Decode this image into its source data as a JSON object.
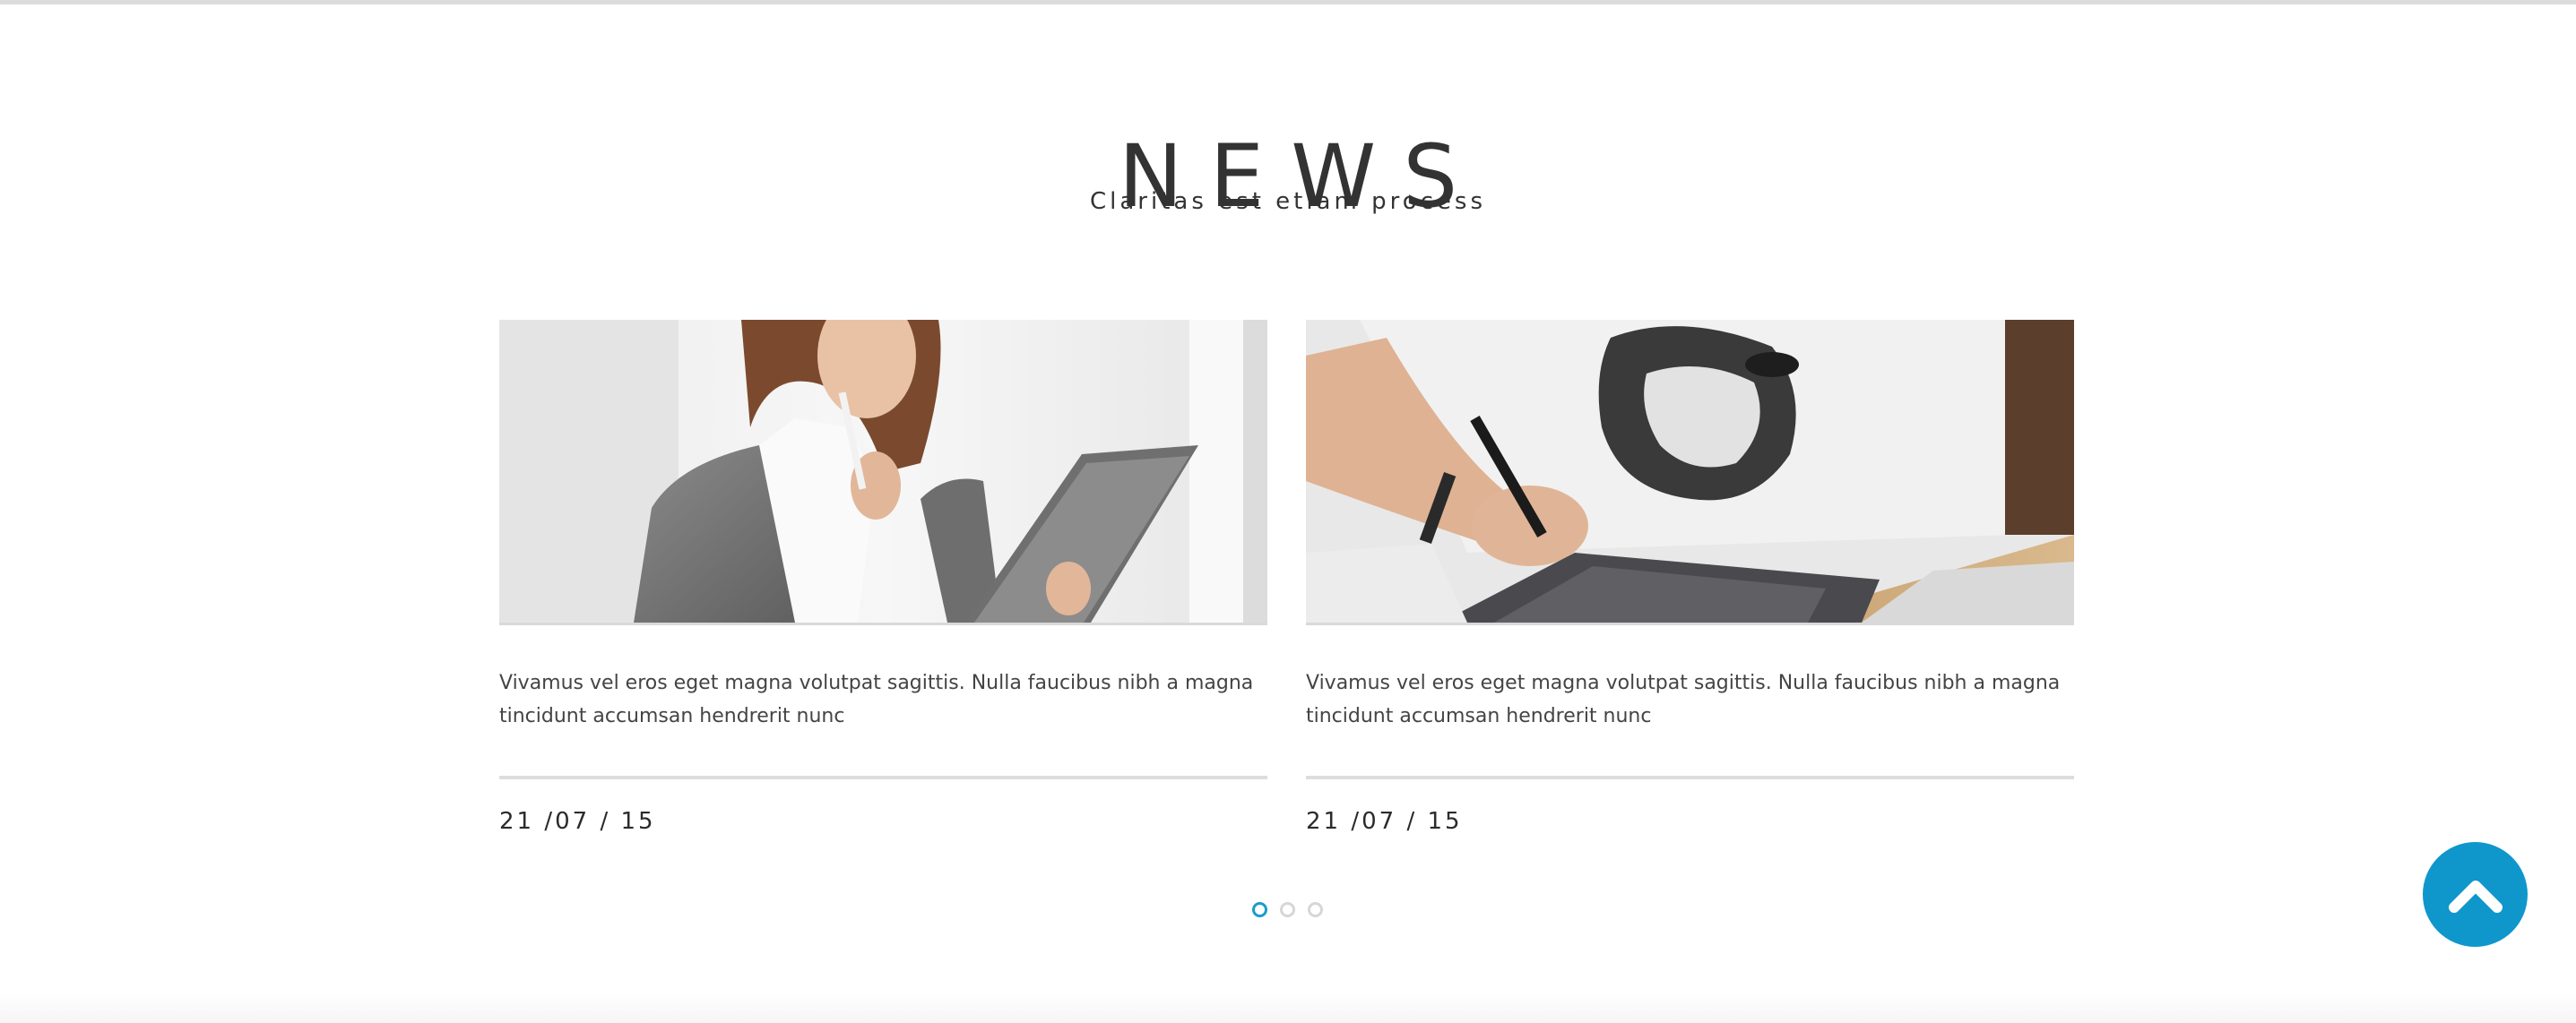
{
  "section": {
    "title": "NEWS",
    "subtitle": "Claritas est etiam process"
  },
  "news": [
    {
      "image": "woman-with-clipboard-photo",
      "excerpt": "Vivamus vel eros eget magna volutpat sagittis. Nulla faucibus nibh a magna tincidunt accumsan hendrerit nunc",
      "date": "21 /07 / 15"
    },
    {
      "image": "man-drawing-on-tablet-photo",
      "excerpt": "Vivamus vel eros eget magna volutpat sagittis. Nulla faucibus nibh a magna tincidunt accumsan hendrerit nunc",
      "date": "21 /07 / 15"
    }
  ],
  "pagination": {
    "pages": 3,
    "active_index": 0
  },
  "scroll_top": {
    "icon": "chevron-up-icon"
  },
  "colors": {
    "accent": "#0f97cc",
    "text": "#333333",
    "rule": "#dddddd"
  }
}
